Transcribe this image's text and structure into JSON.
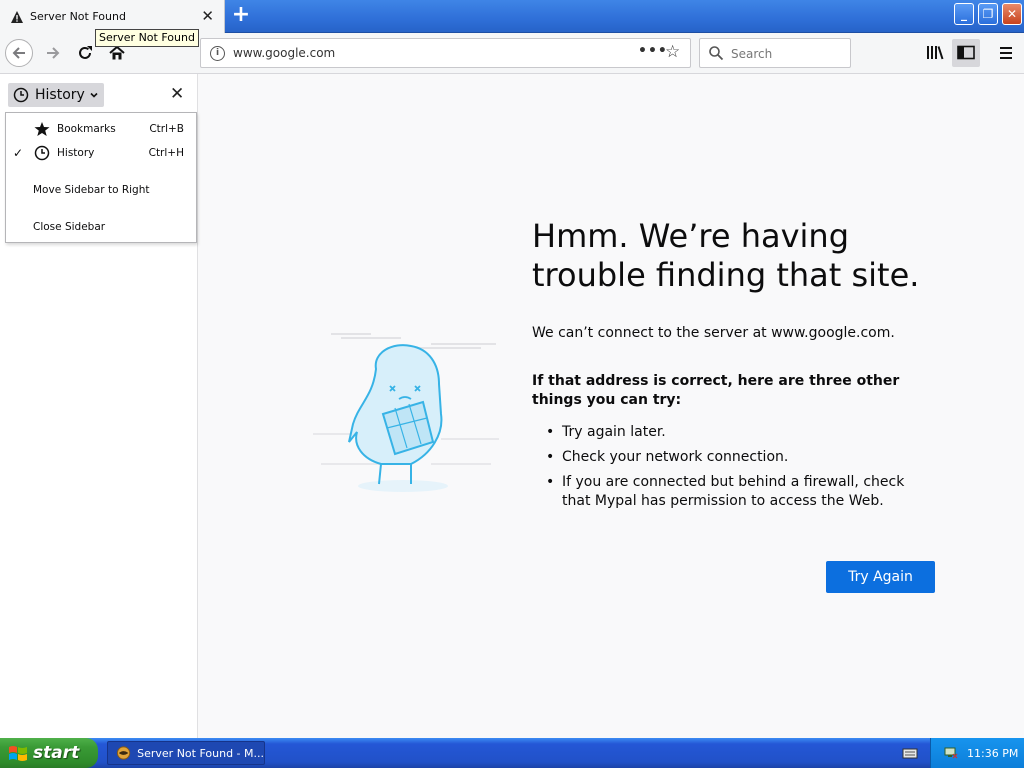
{
  "browser": {
    "tab": {
      "title": "Server Not Found",
      "icon": "warning-icon"
    },
    "tooltip": "Server Not Found",
    "new_tab_label": "+",
    "url": "www.google.com",
    "search_placeholder": "Search",
    "page_actions_label": "•••"
  },
  "sidebar": {
    "title": "History",
    "menu": [
      {
        "label": "Bookmarks",
        "shortcut": "Ctrl+B",
        "icon": "star-icon",
        "checked": false
      },
      {
        "label": "History",
        "shortcut": "Ctrl+H",
        "icon": "clock-icon",
        "checked": true
      },
      {
        "label": "Move Sidebar to Right",
        "shortcut": "",
        "icon": "",
        "checked": false
      },
      {
        "label": "Close Sidebar",
        "shortcut": "",
        "icon": "",
        "checked": false
      }
    ],
    "check_mark": "✓"
  },
  "error": {
    "title": "Hmm. We’re having trouble finding that site.",
    "description": "We can’t connect to the server at www.google.com.",
    "subtitle": "If that address is correct, here are three other things you can try:",
    "suggestions": [
      "Try again later.",
      "Check your network connection.",
      "If you are connected but behind a firewall, check that Mypal has permission to access the Web."
    ],
    "try_again_label": "Try Again"
  },
  "taskbar": {
    "start_label": "start",
    "task_label": "Server Not Found - M...",
    "clock": "11:36 PM"
  },
  "colors": {
    "accent_button": "#0c6fdf",
    "taskbar_blue": "#2457d6",
    "start_green": "#3a9b36",
    "illustration_blue": "#37b3e6"
  }
}
